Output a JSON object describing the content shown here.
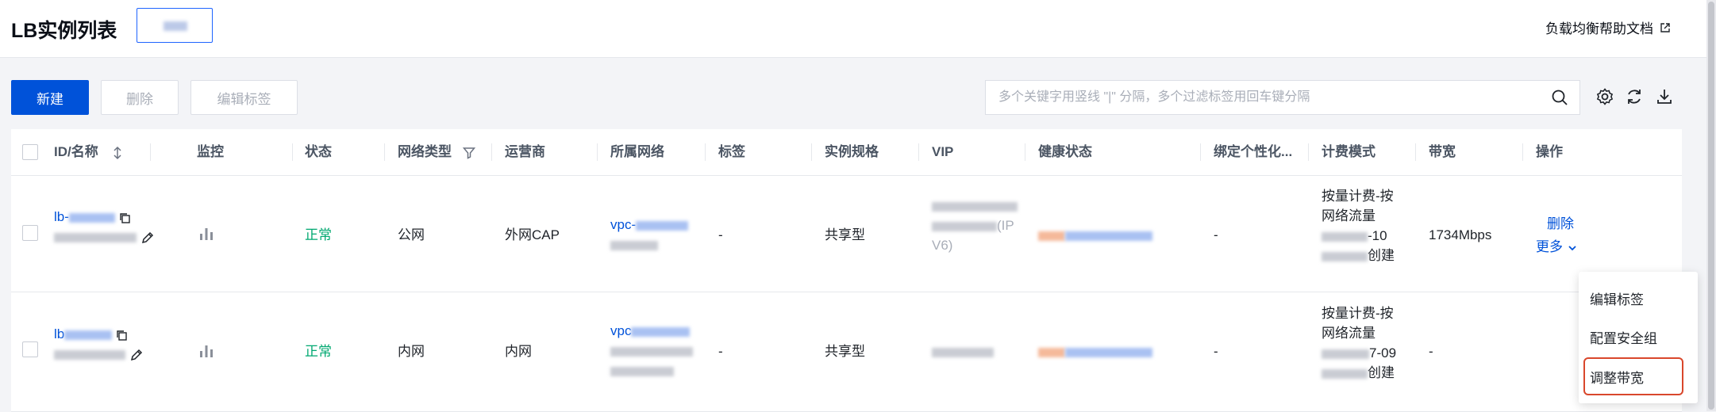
{
  "header": {
    "title": "LB实例列表",
    "help_link": "负载均衡帮助文档"
  },
  "toolbar": {
    "new_label": "新建",
    "delete_label": "删除",
    "edit_tags_label": "编辑标签",
    "search_placeholder": "多个关键字用竖线 \"|\" 分隔，多个过滤标签用回车键分隔"
  },
  "table": {
    "columns": [
      "ID/名称",
      "监控",
      "状态",
      "网络类型",
      "运营商",
      "所属网络",
      "标签",
      "实例规格",
      "VIP",
      "健康状态",
      "绑定个性化...",
      "计费模式",
      "带宽",
      "操作"
    ],
    "rows": [
      {
        "id": "lb-",
        "status": "正常",
        "network_type": "公网",
        "carrier": "外网CAP",
        "vpc": "vpc-",
        "tags": "-",
        "spec": "共享型",
        "vip_suffix": "(IP",
        "vip_suffix2": "V6)",
        "custom": "-",
        "billing_line1": "按量计费-按",
        "billing_line2": "网络流量",
        "billing_date": "-10",
        "billing_created": "创建",
        "bandwidth": "1734Mbps",
        "action_delete": "删除",
        "action_more": "更多"
      },
      {
        "id": "lb",
        "status": "正常",
        "network_type": "内网",
        "carrier": "内网",
        "vpc": "vpc",
        "tags": "-",
        "spec": "共享型",
        "custom": "-",
        "billing_line1": "按量计费-按",
        "billing_line2": "网络流量",
        "billing_date": "7-09",
        "billing_created": "创建",
        "bandwidth": "-"
      }
    ]
  },
  "more_menu": {
    "items": [
      "编辑标签",
      "配置安全组",
      "调整带宽"
    ],
    "highlighted": "调整带宽"
  },
  "colors": {
    "primary": "#0052d9",
    "success": "#00a870",
    "highlight_border": "#d9472c"
  }
}
